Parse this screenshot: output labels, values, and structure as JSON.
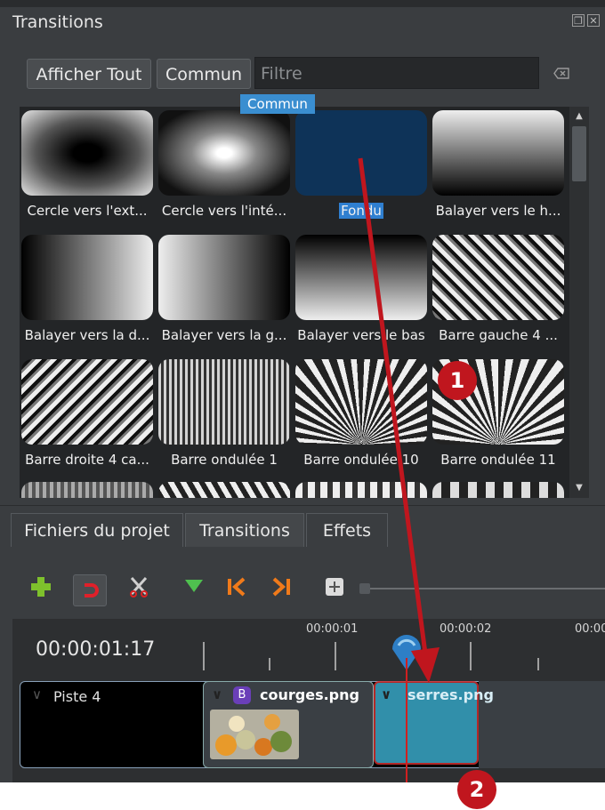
{
  "panel": {
    "title": "Transitions"
  },
  "filter_bar": {
    "show_all_label": "Afficher Tout",
    "common_label": "Commun",
    "filter_placeholder": "Filtre",
    "tooltip": "Commun"
  },
  "transitions": [
    {
      "label": "Cercle vers l'ext...",
      "icon": "radial-dark-center"
    },
    {
      "label": "Cercle vers l'inté...",
      "icon": "radial-light-center"
    },
    {
      "label": "Fondu",
      "icon": "fade-selected"
    },
    {
      "label": "Balayer vers le h...",
      "icon": "vertical-gradient"
    },
    {
      "label": "Balayer vers la d...",
      "icon": "horizontal-gradient"
    },
    {
      "label": "Balayer vers la g...",
      "icon": "horizontal-gradient-reverse"
    },
    {
      "label": "Balayer vers le bas",
      "icon": "vertical-gradient-down"
    },
    {
      "label": "Barre gauche 4 ...",
      "icon": "diagonal-bars"
    },
    {
      "label": "Barre droite 4 ca...",
      "icon": "diagonal-bars-reverse"
    },
    {
      "label": "Barre ondulée 1",
      "icon": "wavy-bars"
    },
    {
      "label": "Barre ondulée 10",
      "icon": "fan-waves"
    },
    {
      "label": "Barre ondulée 11",
      "icon": "fan-waves-alt"
    }
  ],
  "selected_transition": "Fondu",
  "tabs": [
    {
      "label": "Fichiers du projet"
    },
    {
      "label": "Transitions",
      "active": true
    },
    {
      "label": "Effets"
    }
  ],
  "toolbar_icons": [
    "add-icon",
    "snap-icon",
    "razor-icon",
    "marker-icon",
    "previous-marker-icon",
    "next-marker-icon",
    "zoom-icon"
  ],
  "timeline": {
    "current_time": "00:00:01:17",
    "ruler": [
      "00:00:01",
      "00:00:02",
      "00:00"
    ],
    "track_label": "Piste 4",
    "clips": [
      {
        "badge": "B",
        "name": "courges.png"
      },
      {
        "name": "serres.png"
      }
    ]
  },
  "annotations": [
    "1",
    "2"
  ],
  "colors": {
    "accent": "#2f7fd0",
    "arrow": "#c0161e",
    "panel": "#3a3d40"
  }
}
